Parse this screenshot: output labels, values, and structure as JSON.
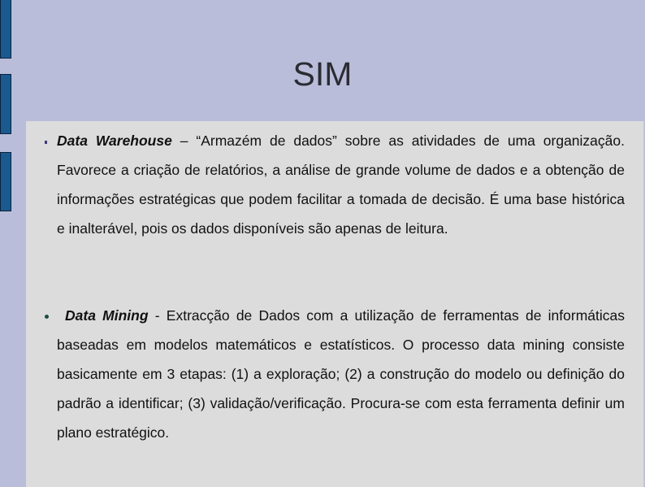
{
  "slide": {
    "title": "SIM",
    "bullets": [
      {
        "icon": "square-bullet-icon",
        "term": "Data Warehouse",
        "separator": " – ",
        "text": "“Armazém de dados” sobre as atividades de uma organização. Favorece a criação de relatórios, a análise de grande volume de dados e a obtenção de informações estratégicas que podem facilitar a tomada de decisão. É uma base histórica e inalterável, pois os dados disponíveis são apenas de leitura."
      },
      {
        "icon": "round-bullet-icon",
        "term": "Data Mining",
        "separator": " - ",
        "text": "Extracção de Dados com a utilização de ferramentas de informáticas baseadas em modelos matemáticos e estatísticos. O processo data mining consiste basicamente em 3 etapas: (1) a exploração; (2) a construção do modelo ou definição do padrão a identificar; (3) validação/verificação. Procura-se com esta ferramenta definir um plano estratégico."
      }
    ]
  },
  "colors": {
    "background": "#b9bdd9",
    "panel": "#dcdcdc",
    "accent_blocks": "#1a5a8e",
    "title_text": "#2b2b33"
  }
}
